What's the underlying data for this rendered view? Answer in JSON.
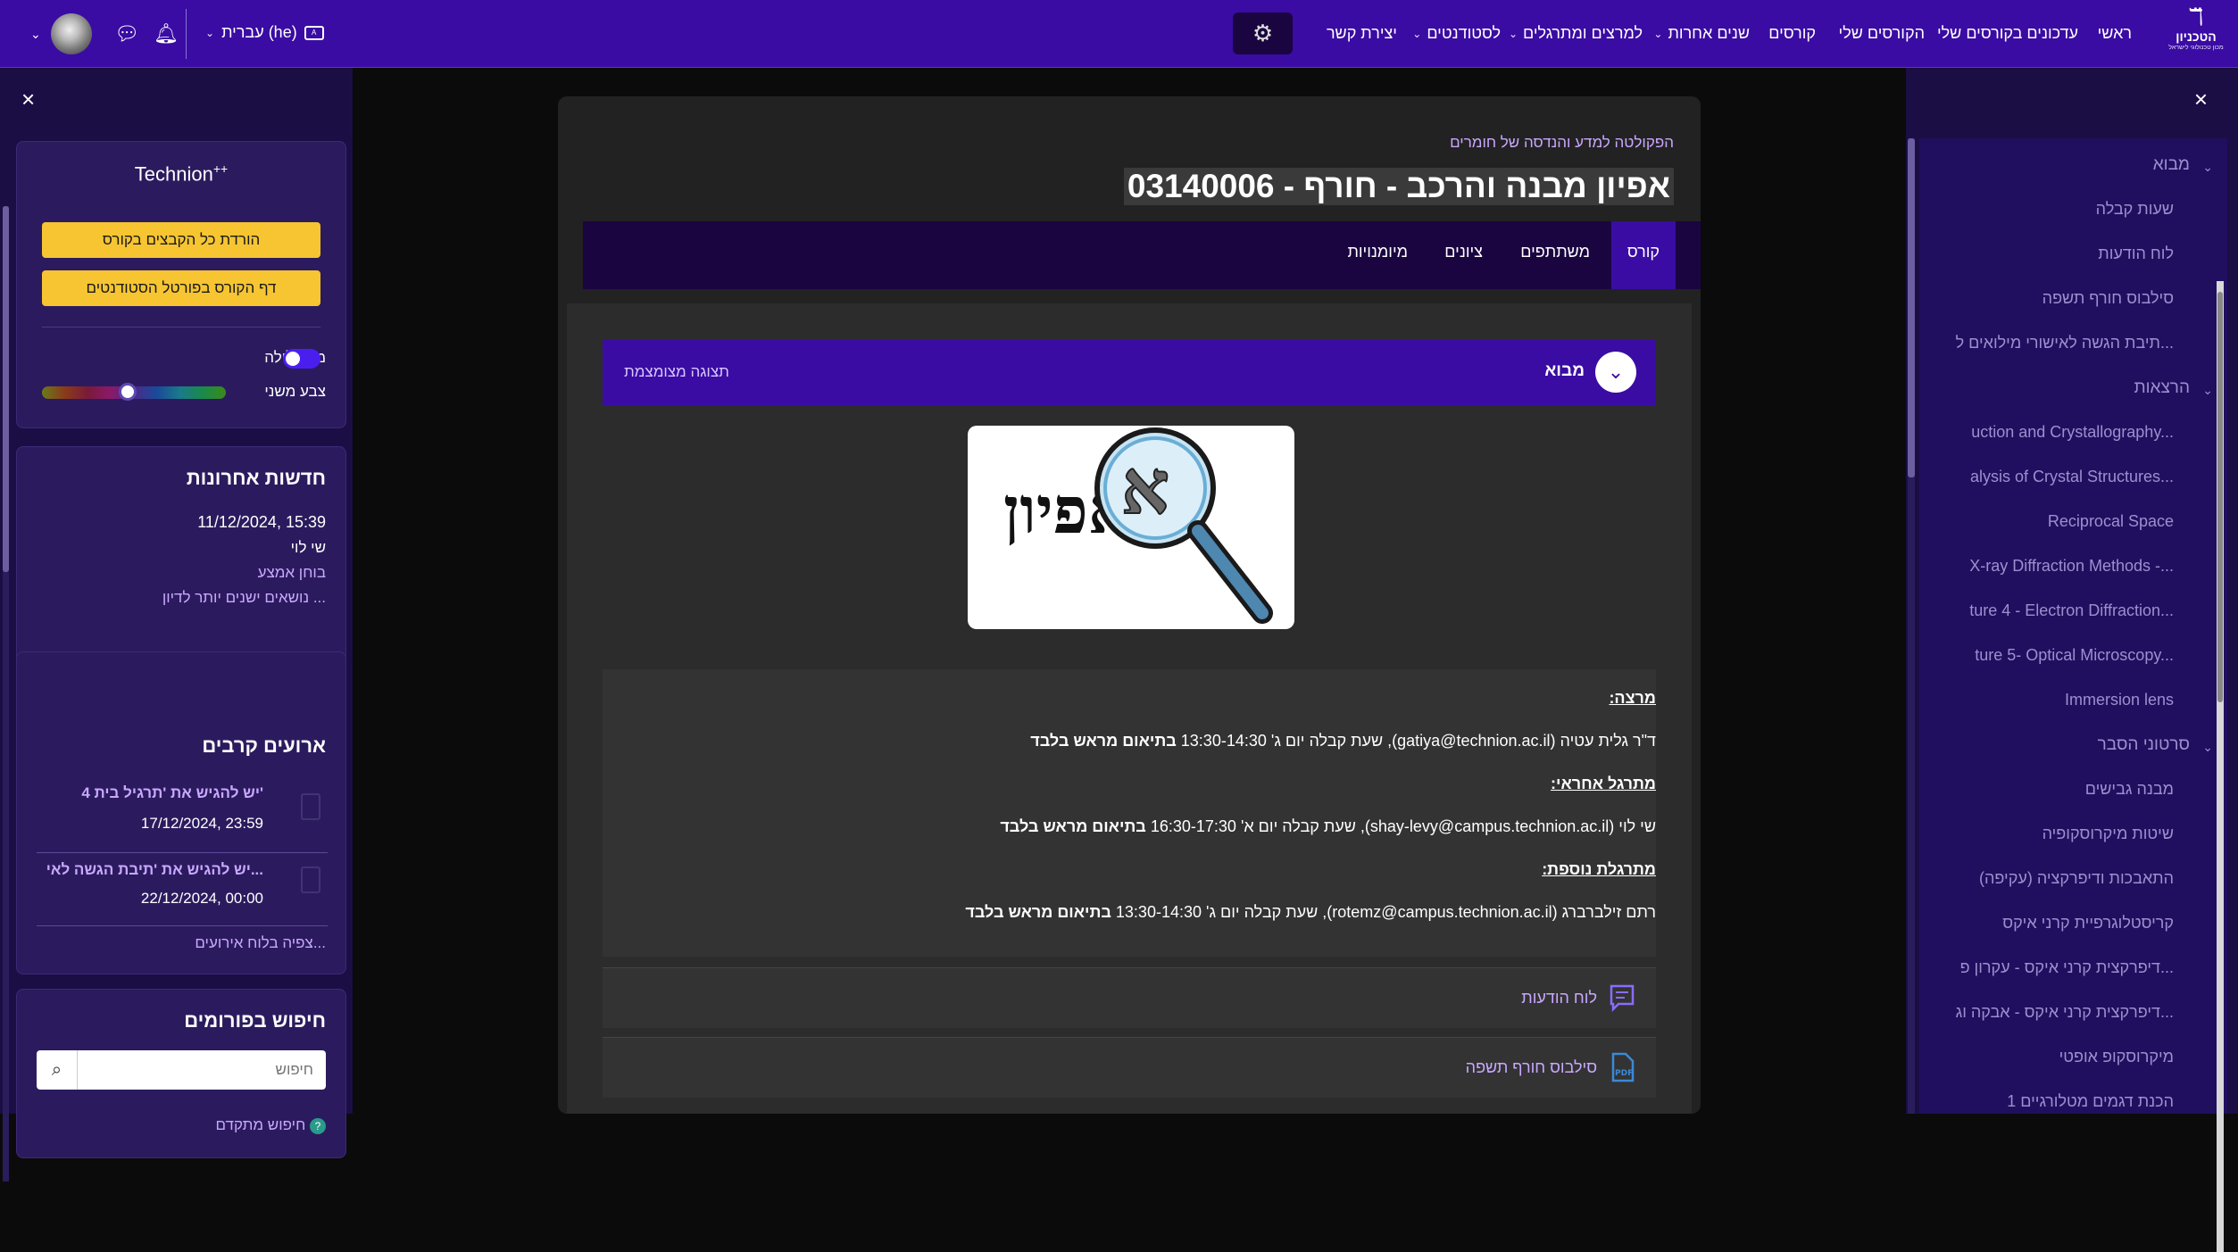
{
  "topbar": {
    "logo": {
      "name_he": "הטכניון",
      "tagline": "מכון טכנולוגי לישראל"
    },
    "nav": [
      {
        "label": "ראשי",
        "dropdown": false
      },
      {
        "label": "עדכונים בקורסים שלי",
        "dropdown": false
      },
      {
        "label": "הקורסים שלי",
        "dropdown": false
      },
      {
        "label": "קורסים",
        "dropdown": false
      },
      {
        "label": "שנים אחרות",
        "dropdown": true
      },
      {
        "label": "למרצים ומתרגלים",
        "dropdown": true
      },
      {
        "label": "לסטודנטים",
        "dropdown": true
      },
      {
        "label": "יצירת קשר",
        "dropdown": false
      }
    ],
    "language": "עברית (he)",
    "icons": [
      "cog-icon",
      "bell-icon",
      "chat-icon",
      "user-avatar"
    ]
  },
  "left_panel": {
    "technion_pp": {
      "title": "Technion",
      "sup": "++"
    },
    "buttons": [
      "הורדת כל הקבצים בקורס",
      "דף הקורס בפורטל הסטודנטים"
    ],
    "night_mode_label": "מצב לילה",
    "secondary_color_label": "צבע משני",
    "news": {
      "title": "חדשות אחרונות",
      "date": "11/12/2024, 15:39",
      "author": "שי לוי",
      "item": "בוחן אמצע",
      "older": "נושאים ישנים יותר לדיון ..."
    },
    "events": {
      "title": "ארועים קרבים",
      "items": [
        {
          "title": "יש להגיש את 'תרגיל בית 4'",
          "date": "17/12/2024, 23:59"
        },
        {
          "title": "יש להגיש את 'תיבת הגשה לאי...",
          "date": "22/12/2024, 00:00"
        }
      ],
      "view_all": "צפיה בלוח אירועים..."
    },
    "forum_search": {
      "title": "חיפוש בפורומים",
      "placeholder": "חיפוש",
      "advanced": "חיפוש מתקדם"
    }
  },
  "main": {
    "faculty": "הפקולטה למדע והנדסה של חומרים",
    "course_title": "אפיון מבנה והרכב - חורף - 03140006",
    "tabs": [
      "קורס",
      "משתתפים",
      "ציונים",
      "מיומנויות"
    ],
    "section": {
      "title": "מבוא",
      "compact_view": "תצוגה מצומצמת"
    },
    "image_text": "אפיון",
    "staff": [
      {
        "heading": "מרצה:",
        "line": "ד\"ר גלית עטיה (gatiya@technion.ac.il), שעת קבלה יום ג' 13:30-14:30 ",
        "bold": "בתיאום מראש בלבד"
      },
      {
        "heading": "מתרגל אחראי:",
        "line": "שי לוי (shay-levy@campus.technion.ac.il), שעת קבלה יום א' 16:30-17:30 ",
        "bold": "בתיאום מראש בלבד"
      },
      {
        "heading": "מתרגלת נוספת:",
        "line": "רתם זילברברג (rotemz@campus.technion.ac.il), שעת קבלה יום ג' 13:30-14:30 ",
        "bold": "בתיאום מראש בלבד"
      }
    ],
    "activities": [
      {
        "label": "לוח הודעות",
        "icon": "forum-icon"
      },
      {
        "label": "סילבוס חורף תשפה",
        "icon": "pdf-icon"
      }
    ]
  },
  "right_panel": {
    "items": [
      {
        "label": "מבוא",
        "type": "section"
      },
      {
        "label": "שעות קבלה",
        "type": "item"
      },
      {
        "label": "לוח הודעות",
        "type": "item"
      },
      {
        "label": "סילבוס חורף תשפה",
        "type": "item"
      },
      {
        "label": "תיבת הגשה לאישורי מילואים ל...",
        "type": "item"
      },
      {
        "label": "הרצאות",
        "type": "section"
      },
      {
        "label": "uction and Crystallography...",
        "type": "item"
      },
      {
        "label": "alysis of Crystal Structures...",
        "type": "item"
      },
      {
        "label": "Reciprocal Space",
        "type": "item"
      },
      {
        "label": "X-ray Diffraction Methods -...",
        "type": "item"
      },
      {
        "label": "ture 4 - Electron Diffraction...",
        "type": "item"
      },
      {
        "label": "ture 5- Optical Microscopy...",
        "type": "item"
      },
      {
        "label": "Immersion lens",
        "type": "item"
      },
      {
        "label": "סרטוני הסבר",
        "type": "section"
      },
      {
        "label": "מבנה גבישים",
        "type": "item"
      },
      {
        "label": "שיטות מיקרוסקופיה",
        "type": "item"
      },
      {
        "label": "התאבכות ודיפרקציה (עקיפה)",
        "type": "item"
      },
      {
        "label": "קריסטלוגרפיית קרני איקס",
        "type": "item"
      },
      {
        "label": "דיפרקצית קרני איקס - עקרון פ...",
        "type": "item"
      },
      {
        "label": "דיפרקצית קרני איקס - אבקה וג...",
        "type": "item"
      },
      {
        "label": "מיקרוסקופ אופטי",
        "type": "item"
      },
      {
        "label": "הכנת דגמים מטלורגיים 1",
        "type": "item"
      }
    ]
  },
  "colors": {
    "topbar": "#3a0ca3",
    "accent_link": "#c9a8ff",
    "button_yellow": "#f6c531"
  }
}
